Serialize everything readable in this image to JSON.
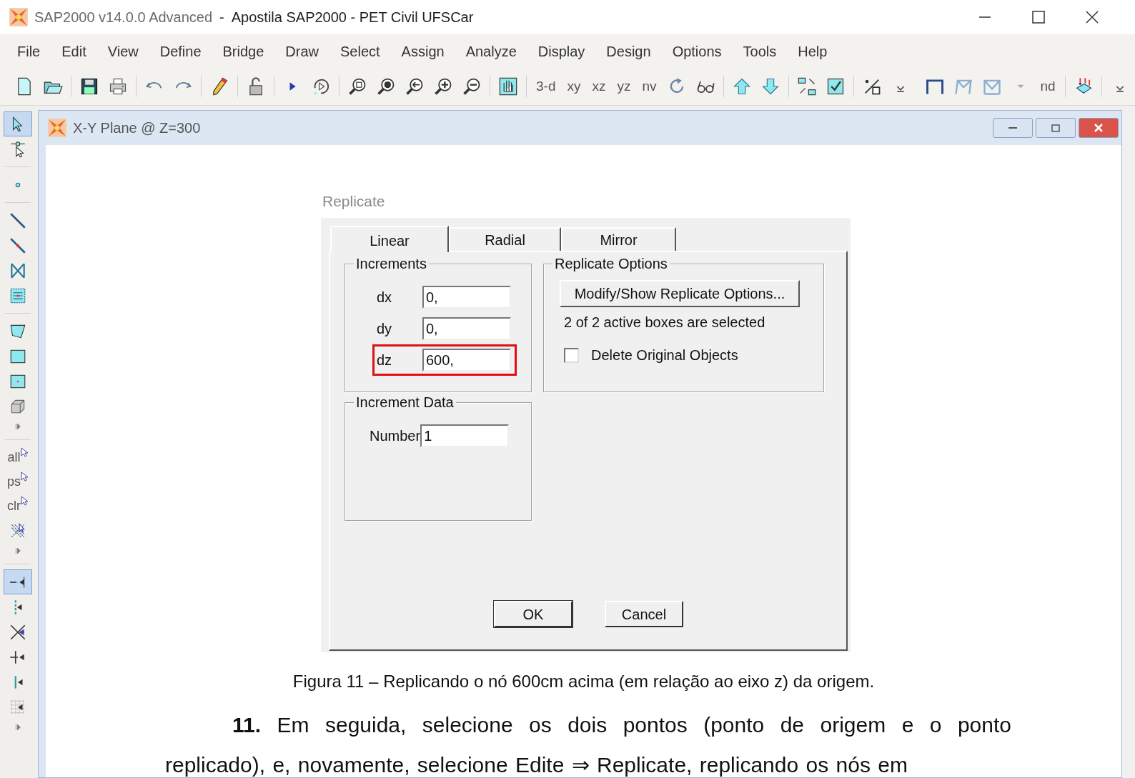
{
  "window": {
    "title_app": "SAP2000 v14.0.0 Advanced",
    "title_document": "-  Apostila SAP2000 - PET Civil UFSCar"
  },
  "menu": [
    "File",
    "Edit",
    "View",
    "Define",
    "Bridge",
    "Draw",
    "Select",
    "Assign",
    "Analyze",
    "Display",
    "Design",
    "Options",
    "Tools",
    "Help"
  ],
  "toolbar": {
    "labels": [
      "3-d",
      "xy",
      "xz",
      "yz",
      "nv",
      "nd"
    ]
  },
  "side_toolbar": {
    "groups": [
      [
        {
          "kind": "pointer",
          "selected": true
        },
        {
          "kind": "joint-pointer",
          "selected": false
        }
      ],
      [
        {
          "kind": "dot",
          "selected": false
        }
      ],
      [
        {
          "kind": "line",
          "selected": false
        },
        {
          "kind": "line-node",
          "selected": false
        },
        {
          "kind": "cross-brace",
          "selected": false
        },
        {
          "kind": "area-grid",
          "selected": false
        }
      ],
      [
        {
          "kind": "polygon",
          "selected": false
        },
        {
          "kind": "rectangle",
          "selected": false
        },
        {
          "kind": "rectangle-node",
          "selected": false
        },
        {
          "kind": "cube",
          "selected": false
        },
        {
          "kind": "expand",
          "selected": false
        }
      ],
      [
        {
          "kind": "text",
          "label": "all",
          "selected": false
        },
        {
          "kind": "text",
          "label": "ps",
          "selected": false
        },
        {
          "kind": "text",
          "label": "clr",
          "selected": false
        },
        {
          "kind": "hatched",
          "selected": false
        },
        {
          "kind": "expand",
          "selected": false
        }
      ],
      [
        {
          "kind": "snap-mid",
          "selected": true
        },
        {
          "kind": "snap-joint",
          "selected": false
        },
        {
          "kind": "snap-cross",
          "selected": false
        },
        {
          "kind": "snap-perp",
          "selected": false
        },
        {
          "kind": "snap-end",
          "selected": false
        },
        {
          "kind": "snap-grid",
          "selected": false
        },
        {
          "kind": "expand",
          "selected": false
        }
      ]
    ]
  },
  "inner_window": {
    "title": "X-Y Plane @ Z=300"
  },
  "dialog": {
    "title": "Replicate",
    "tabs": [
      {
        "label": "Linear",
        "selected": true
      },
      {
        "label": "Radial",
        "selected": false
      },
      {
        "label": "Mirror",
        "selected": false
      }
    ],
    "increments": {
      "legend": "Increments",
      "fields": [
        {
          "label": "dx",
          "value": "0,",
          "highlighted": false
        },
        {
          "label": "dy",
          "value": "0,",
          "highlighted": false
        },
        {
          "label": "dz",
          "value": "600,",
          "highlighted": true
        }
      ]
    },
    "increment_data": {
      "legend": "Increment Data",
      "fields": [
        {
          "label": "Number",
          "value": "1"
        }
      ]
    },
    "replicate_options": {
      "legend": "Replicate Options",
      "button": "Modify/Show Replicate Options...",
      "status": "2 of 2 active boxes are selected",
      "checkbox": {
        "label": "Delete Original Objects",
        "checked": false
      }
    },
    "buttons": [
      "OK",
      "Cancel"
    ]
  },
  "caption": "Figura 11 – Replicando o nó 600cm acima (em relação ao eixo z) da origem.",
  "paragraph": "**11.** Em seguida, selecione os dois pontos (ponto de origem e o ponto replicado), e, novamente, selecione Edite ⇒ Replicate, replicando os nós em"
}
